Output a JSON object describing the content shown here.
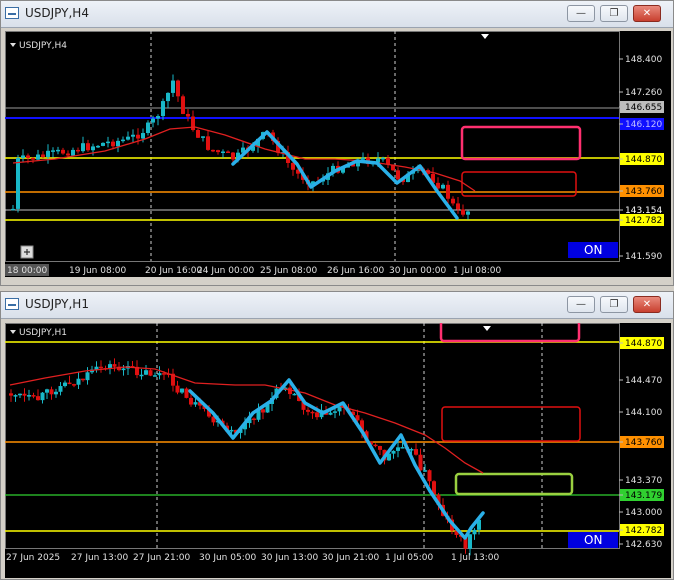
{
  "window1": {
    "title": "USDJPY,H4",
    "symbol_label": "USDJPY,H4",
    "buttons": {
      "minimize": "—",
      "restore": "❐",
      "close": "✕"
    },
    "on_button": "ON",
    "price_labels": [
      "148.400",
      "147.260",
      "146.655",
      "146.120",
      "144.870",
      "143.760",
      "143.154",
      "142.782",
      "141.590"
    ],
    "time_labels": [
      "18 00:00",
      "19 Jun 08:00",
      "20 Jun 16:00",
      "24 Jun 00:00",
      "25 Jun 08:00",
      "26 Jun 16:00",
      "30 Jun 00:00",
      "1 Jul 08:00"
    ]
  },
  "window2": {
    "title": "USDJPY,H1",
    "symbol_label": "USDJPY,H1",
    "buttons": {
      "minimize": "—",
      "restore": "❐",
      "close": "✕"
    },
    "on_button": "ON",
    "price_labels": [
      "144.870",
      "144.470",
      "144.100",
      "143.760",
      "143.370",
      "143.179",
      "143.000",
      "142.782",
      "142.630"
    ],
    "time_labels": [
      "27 Jun 2025",
      "27 Jun 13:00",
      "27 Jun 21:00",
      "30 Jun 05:00",
      "30 Jun 13:00",
      "30 Jun 21:00",
      "1 Jul 05:00",
      "1 Jul 13:00"
    ]
  },
  "colors": {
    "background": "#000000",
    "bull_candle": "#19b8c8",
    "bear_candle": "#e01010",
    "moving_average": "#e02020",
    "wave_line": "#2ab0e8",
    "yellow_level": "#ffff00",
    "orange_level": "#ff9000",
    "blue_level": "#1010ff",
    "green_level": "#30d030",
    "pink_box": "#ff3070",
    "red_box": "#e01010",
    "green_box": "#9ad040"
  }
}
